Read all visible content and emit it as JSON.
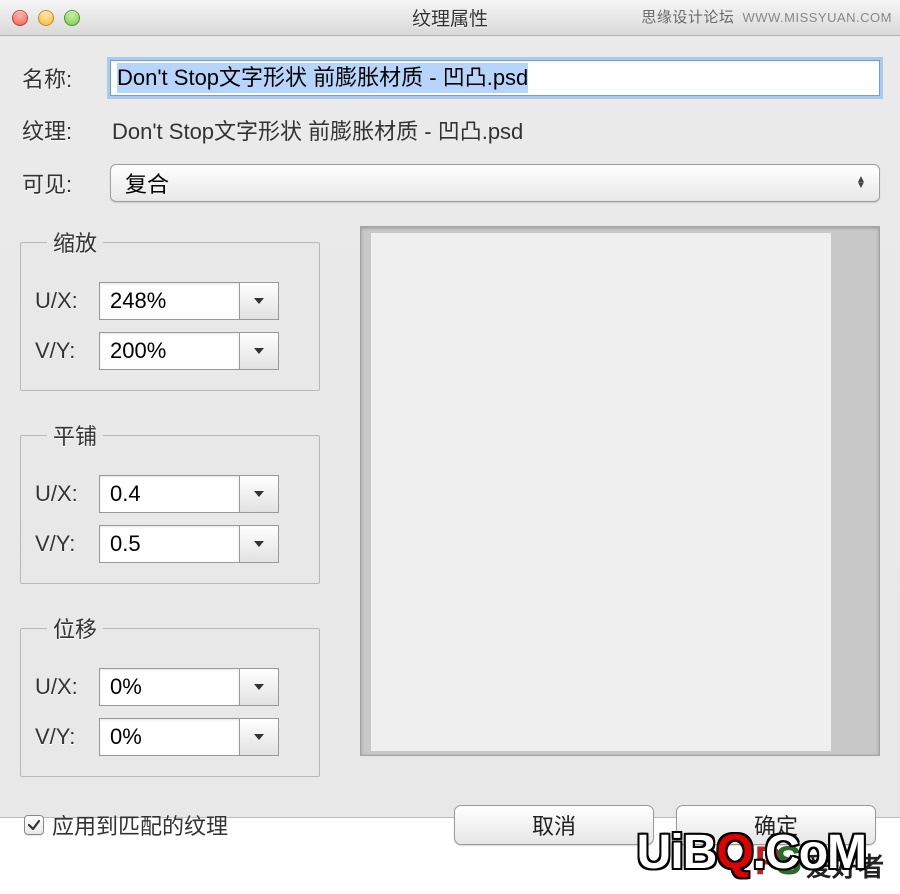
{
  "window": {
    "title": "纹理属性"
  },
  "watermark_top": {
    "cn": "思缘设计论坛",
    "url": "WWW.MISSYUAN.COM"
  },
  "labels": {
    "name": "名称:",
    "texture": "纹理:",
    "visible": "可见:"
  },
  "name_value": "Don't Stop文字形状 前膨胀材质 - 凹凸.psd",
  "texture_value": "Don't Stop文字形状 前膨胀材质 - 凹凸.psd",
  "visible_value": "复合",
  "groups": {
    "scale": {
      "title": "缩放",
      "ux_label": "U/X:",
      "ux_value": "248%",
      "vy_label": "V/Y:",
      "vy_value": "200%"
    },
    "tile": {
      "title": "平铺",
      "ux_label": "U/X:",
      "ux_value": "0.4",
      "vy_label": "V/Y:",
      "vy_value": "0.5"
    },
    "offset": {
      "title": "位移",
      "ux_label": "U/X:",
      "ux_value": "0%",
      "vy_label": "V/Y:",
      "vy_value": "0%"
    }
  },
  "apply_checkbox": {
    "checked": true,
    "label": "应用到匹配的纹理"
  },
  "buttons": {
    "cancel": "取消",
    "ok": "确定"
  },
  "watermark_bottom": {
    "ps_cn": "爱好者",
    "uibq": "UiBQ.CoM"
  }
}
